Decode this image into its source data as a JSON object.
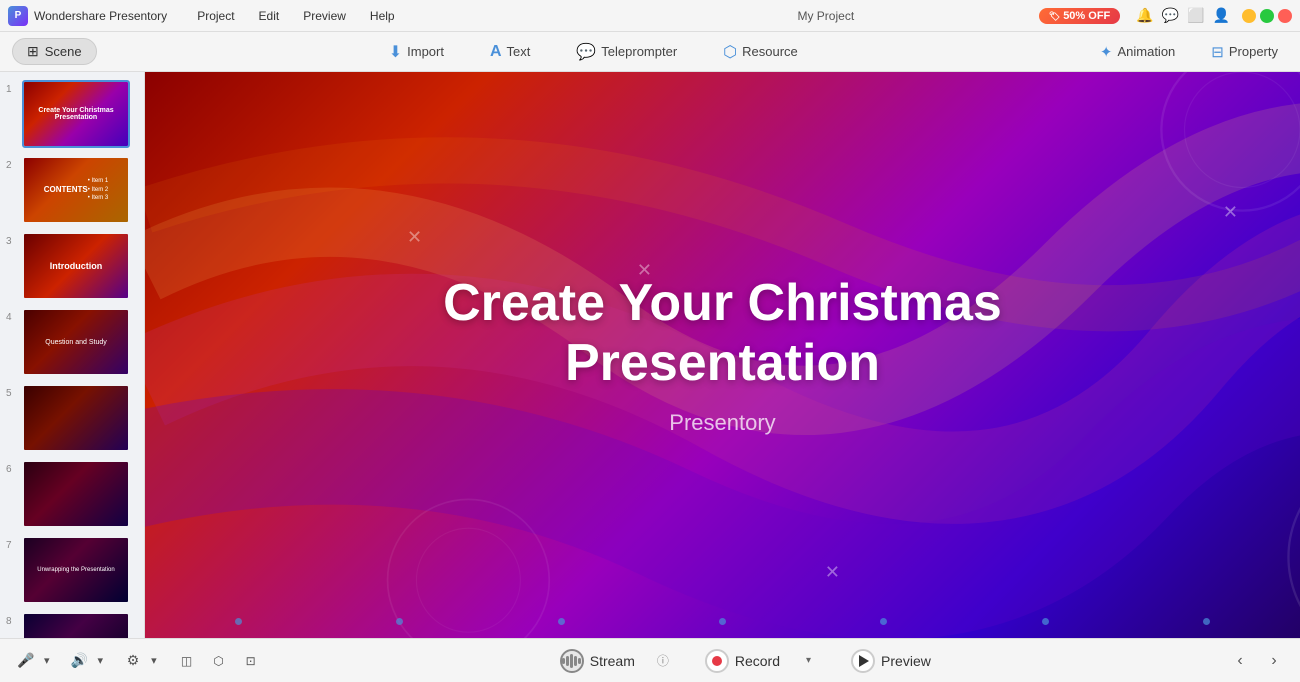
{
  "titlebar": {
    "app_name": "Wondershare Presentory",
    "menus": [
      "Project",
      "Edit",
      "Preview",
      "Help"
    ],
    "project_title": "My Project",
    "promo_label": "50% OFF"
  },
  "toolbar": {
    "scene_label": "Scene",
    "tools": [
      {
        "id": "import",
        "label": "Import",
        "icon": "import-icon"
      },
      {
        "id": "text",
        "label": "Text",
        "icon": "text-icon"
      },
      {
        "id": "teleprompter",
        "label": "Teleprompter",
        "icon": "teleprompter-icon"
      },
      {
        "id": "resource",
        "label": "Resource",
        "icon": "resource-icon"
      }
    ],
    "right_tools": [
      {
        "id": "animation",
        "label": "Animation",
        "icon": "animation-icon"
      },
      {
        "id": "property",
        "label": "Property",
        "icon": "property-icon"
      }
    ]
  },
  "slides": [
    {
      "number": 1,
      "style": "slide1",
      "active": true,
      "title": "Create Your Christmas Presentation"
    },
    {
      "number": 2,
      "style": "slide2",
      "active": false,
      "title": "Contents"
    },
    {
      "number": 3,
      "style": "slide3",
      "active": false,
      "title": "Introduction"
    },
    {
      "number": 4,
      "style": "slide4",
      "active": false,
      "title": "Question and Study"
    },
    {
      "number": 5,
      "style": "slide5",
      "active": false,
      "title": ""
    },
    {
      "number": 6,
      "style": "slide6",
      "active": false,
      "title": ""
    },
    {
      "number": 7,
      "style": "slide7",
      "active": false,
      "title": "Unwrapping the Presentation"
    },
    {
      "number": 8,
      "style": "slide8",
      "active": false,
      "title": ""
    }
  ],
  "main_slide": {
    "title": "Create Your Christmas\nPresentation",
    "subtitle": "Presentory"
  },
  "bottom_bar": {
    "stream_label": "Stream",
    "record_label": "Record",
    "preview_label": "Preview"
  }
}
